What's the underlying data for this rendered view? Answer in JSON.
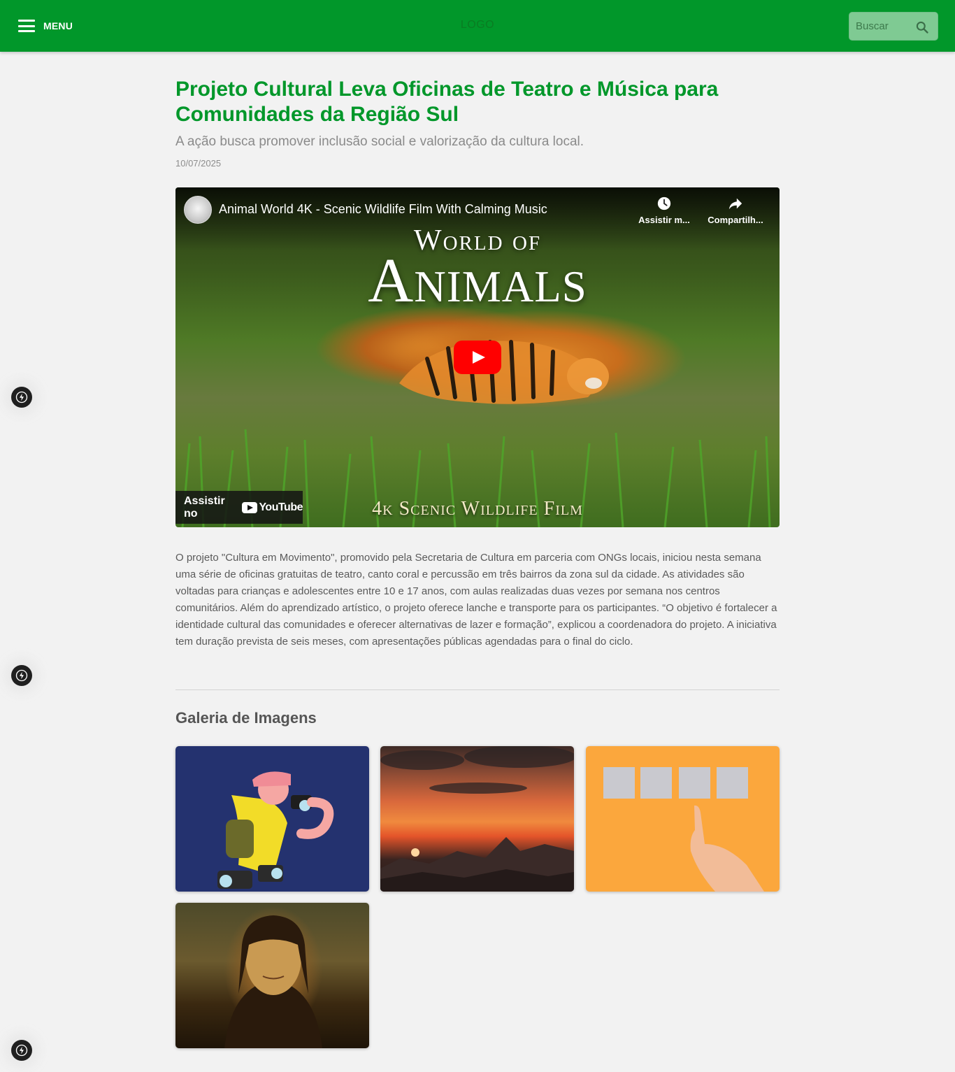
{
  "header": {
    "menu_label": "MENU",
    "logo_text": "LOGO",
    "search_placeholder": "Buscar",
    "brand_color": "#01972a"
  },
  "article": {
    "title": "Projeto Cultural Leva Oficinas de Teatro e Música para Comunidades da Região Sul",
    "subtitle": "A ação busca promover inclusão social e valorização da cultura local.",
    "date": "10/07/2025",
    "body": "O projeto \"Cultura em Movimento\", promovido pela Secretaria de Cultura em parceria com ONGs locais, iniciou nesta semana uma série de oficinas gratuitas de teatro, canto coral e percussão em três bairros da zona sul da cidade. As atividades são voltadas para crianças e adolescentes entre 10 e 17 anos, com aulas realizadas duas vezes por semana nos centros comunitários. Além do aprendizado artístico, o projeto oferece lanche e transporte para os participantes. “O objetivo é fortalecer a identidade cultural das comunidades e oferecer alternativas de lazer e formação”, explicou a coordenadora do projeto. A iniciativa tem duração prevista de seis meses, com apresentações públicas agendadas para o final do ciclo."
  },
  "video": {
    "title": "Animal World 4K - Scenic Wildlife Film With Calming Music",
    "watch_later_label": "Assistir m...",
    "share_label": "Compartilh...",
    "thumbnail_line1": "World of",
    "thumbnail_line2": "Animals",
    "thumbnail_line3": "4k Scenic Wildlife Film",
    "watch_on_label": "Assistir no",
    "youtube_word": "YouTube"
  },
  "gallery": {
    "title": "Galeria de Imagens",
    "images": [
      {
        "name": "cartoon-photographer"
      },
      {
        "name": "sunset-mountains"
      },
      {
        "name": "hand-pointing-sticky-notes"
      },
      {
        "name": "mona-lisa"
      }
    ]
  }
}
